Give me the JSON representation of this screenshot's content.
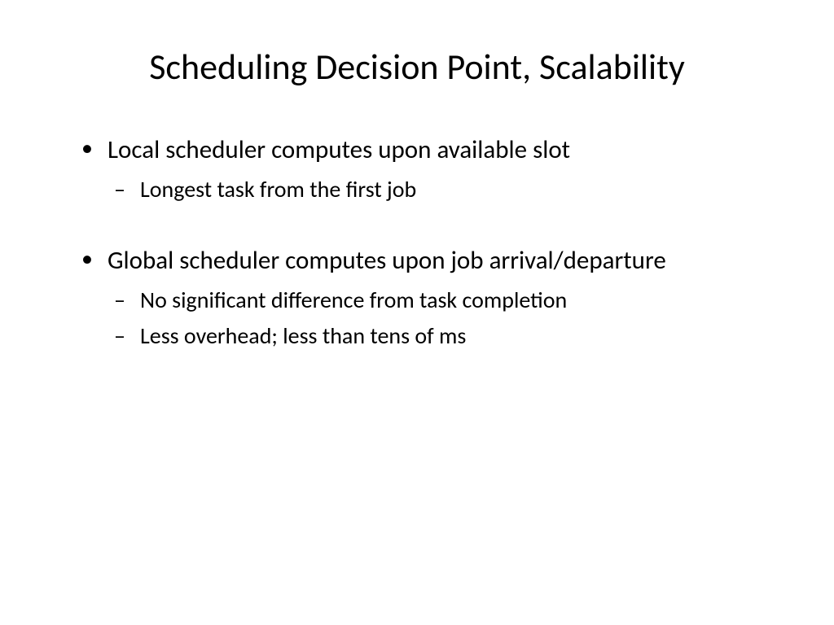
{
  "title": "Scheduling Decision Point, Scalability",
  "bullets": [
    {
      "text": "Local scheduler computes upon available slot",
      "sub": [
        "Longest task from the first job"
      ]
    },
    {
      "text": "Global scheduler computes upon job arrival/departure",
      "sub": [
        "No significant difference from task completion",
        "Less overhead; less than tens of ms"
      ]
    }
  ]
}
